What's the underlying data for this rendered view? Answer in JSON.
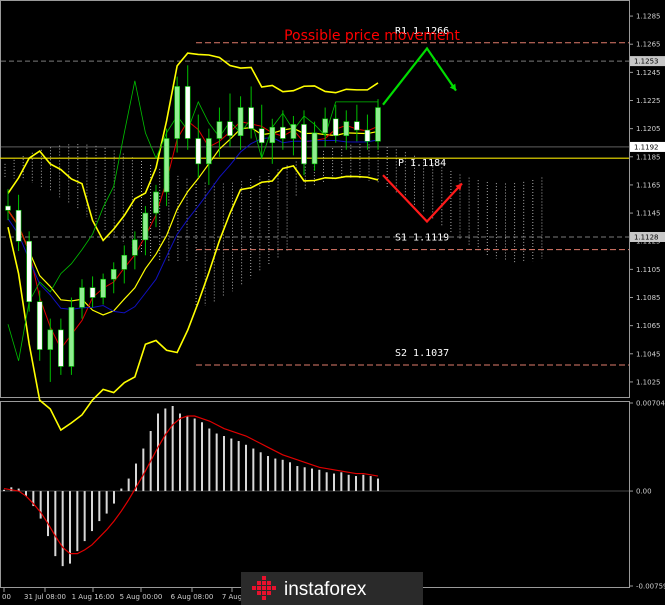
{
  "chart_data": [
    {
      "type": "candlestick",
      "title": "Possible price movement",
      "ylim": [
        1.1015,
        1.1295
      ],
      "y_ticks": [
        1.1285,
        1.1265,
        1.1245,
        1.1225,
        1.1205,
        1.1185,
        1.1165,
        1.1145,
        1.1125,
        1.1105,
        1.1085,
        1.1065,
        1.1045,
        1.1025
      ],
      "x_ticks": [
        "00",
        "31 Jul 08:00",
        "1 Aug 16:00",
        "5 Aug 00:00",
        "6 Aug 08:00",
        "7 Aug"
      ],
      "current_price_tag": "1.1192",
      "tag_1253": "1.1253",
      "tag_1128": "1.1128",
      "levels": [
        {
          "name": "R1",
          "label": "R1  1.1266",
          "value": 1.1266,
          "color": "#e07b6b"
        },
        {
          "name": "P",
          "label": "P  1.1184",
          "value": 1.1184,
          "color": "#f2e200"
        },
        {
          "name": "S1",
          "label": "S1  1.1119",
          "value": 1.1119,
          "color": "#e07b6b"
        },
        {
          "name": "S2",
          "label": "S2  1.1037",
          "value": 1.1037,
          "color": "#e07b6b"
        }
      ],
      "grey_lines": [
        1.1253,
        1.1128
      ],
      "colors": {
        "background": "#000000",
        "bull_body": "#90ee90",
        "bear_body": "#ffffff",
        "wick": "#00c000",
        "bollinger": "#ffff00",
        "tenkan": "#e00000",
        "kijun": "#1010c0",
        "chikou": "#00c000",
        "cloud_a": "#c8c8c8",
        "cloud_b": "#e08020",
        "arrow_up": "#00dd00",
        "arrow_down": "#ff1a1a"
      },
      "candles": [
        {
          "o": 1.115,
          "h": 1.1162,
          "l": 1.114,
          "c": 1.1147
        },
        {
          "o": 1.1147,
          "h": 1.1158,
          "l": 1.1118,
          "c": 1.1125
        },
        {
          "o": 1.1125,
          "h": 1.1132,
          "l": 1.1075,
          "c": 1.1082
        },
        {
          "o": 1.1082,
          "h": 1.109,
          "l": 1.104,
          "c": 1.1048
        },
        {
          "o": 1.1048,
          "h": 1.107,
          "l": 1.1025,
          "c": 1.1062
        },
        {
          "o": 1.1062,
          "h": 1.107,
          "l": 1.103,
          "c": 1.1036
        },
        {
          "o": 1.1036,
          "h": 1.1085,
          "l": 1.103,
          "c": 1.1078
        },
        {
          "o": 1.1078,
          "h": 1.1098,
          "l": 1.107,
          "c": 1.1092
        },
        {
          "o": 1.1092,
          "h": 1.11,
          "l": 1.1078,
          "c": 1.1085
        },
        {
          "o": 1.1085,
          "h": 1.1102,
          "l": 1.108,
          "c": 1.1098
        },
        {
          "o": 1.1098,
          "h": 1.111,
          "l": 1.1088,
          "c": 1.1105
        },
        {
          "o": 1.1105,
          "h": 1.1122,
          "l": 1.1095,
          "c": 1.1115
        },
        {
          "o": 1.1115,
          "h": 1.1132,
          "l": 1.1105,
          "c": 1.1126
        },
        {
          "o": 1.1126,
          "h": 1.115,
          "l": 1.1115,
          "c": 1.1145
        },
        {
          "o": 1.1145,
          "h": 1.1165,
          "l": 1.1135,
          "c": 1.116
        },
        {
          "o": 1.116,
          "h": 1.1205,
          "l": 1.115,
          "c": 1.1198
        },
        {
          "o": 1.1198,
          "h": 1.1242,
          "l": 1.1188,
          "c": 1.1235
        },
        {
          "o": 1.1235,
          "h": 1.125,
          "l": 1.119,
          "c": 1.1198
        },
        {
          "o": 1.1198,
          "h": 1.1215,
          "l": 1.117,
          "c": 1.118
        },
        {
          "o": 1.118,
          "h": 1.1205,
          "l": 1.1165,
          "c": 1.1198
        },
        {
          "o": 1.1198,
          "h": 1.122,
          "l": 1.1185,
          "c": 1.121
        },
        {
          "o": 1.121,
          "h": 1.123,
          "l": 1.1192,
          "c": 1.12
        },
        {
          "o": 1.12,
          "h": 1.1228,
          "l": 1.119,
          "c": 1.122
        },
        {
          "o": 1.122,
          "h": 1.1235,
          "l": 1.1198,
          "c": 1.1205
        },
        {
          "o": 1.1205,
          "h": 1.1222,
          "l": 1.1185,
          "c": 1.1195
        },
        {
          "o": 1.1195,
          "h": 1.1212,
          "l": 1.118,
          "c": 1.1206
        },
        {
          "o": 1.1206,
          "h": 1.1218,
          "l": 1.119,
          "c": 1.1198
        },
        {
          "o": 1.1198,
          "h": 1.1214,
          "l": 1.1186,
          "c": 1.1208
        },
        {
          "o": 1.1208,
          "h": 1.1218,
          "l": 1.1172,
          "c": 1.118
        },
        {
          "o": 1.118,
          "h": 1.121,
          "l": 1.1175,
          "c": 1.1202
        },
        {
          "o": 1.1202,
          "h": 1.122,
          "l": 1.1192,
          "c": 1.1212
        },
        {
          "o": 1.1212,
          "h": 1.1222,
          "l": 1.1195,
          "c": 1.12
        },
        {
          "o": 1.12,
          "h": 1.1218,
          "l": 1.119,
          "c": 1.121
        },
        {
          "o": 1.121,
          "h": 1.1222,
          "l": 1.1196,
          "c": 1.1204
        },
        {
          "o": 1.1204,
          "h": 1.1215,
          "l": 1.119,
          "c": 1.1196
        },
        {
          "o": 1.1196,
          "h": 1.1226,
          "l": 1.119,
          "c": 1.122
        }
      ],
      "macd_ylim": [
        -0.00759,
        0.00704
      ],
      "macd_ticks": [
        "0.00704",
        "0.00",
        "-0.00759"
      ],
      "macd_hist": [
        0.0001,
        0.0003,
        0.0002,
        -0.0004,
        -0.0012,
        -0.0022,
        -0.0036,
        -0.0052,
        -0.006,
        -0.0058,
        -0.0048,
        -0.004,
        -0.0032,
        -0.0024,
        -0.0018,
        -0.001,
        0.0002,
        0.001,
        0.0022,
        0.0034,
        0.0048,
        0.0062,
        0.0066,
        0.0068,
        0.0062,
        0.006,
        0.0058,
        0.0055,
        0.005,
        0.0046,
        0.0044,
        0.0042,
        0.004,
        0.0037,
        0.0034,
        0.0031,
        0.0028,
        0.0026,
        0.0025,
        0.0023,
        0.002,
        0.0019,
        0.0018,
        0.0017,
        0.0015,
        0.0014,
        0.0015,
        0.0013,
        0.0012,
        0.0013,
        0.0012,
        0.001
      ],
      "macd_signal": [
        0.0002,
        0.0001,
        0.0,
        -0.0004,
        -0.001,
        -0.0017,
        -0.0026,
        -0.0036,
        -0.0045,
        -0.005,
        -0.005,
        -0.0047,
        -0.0043,
        -0.0037,
        -0.0031,
        -0.0024,
        -0.0016,
        -0.0007,
        0.0003,
        0.0013,
        0.0024,
        0.0035,
        0.0045,
        0.0053,
        0.0058,
        0.006,
        0.006,
        0.0058,
        0.0056,
        0.0053,
        0.005,
        0.0048,
        0.0046,
        0.0044,
        0.0041,
        0.0038,
        0.0035,
        0.0032,
        0.0029,
        0.0027,
        0.0025,
        0.0023,
        0.0021,
        0.0019,
        0.0018,
        0.0017,
        0.0016,
        0.0015,
        0.0014,
        0.0014,
        0.0013,
        0.0012
      ]
    }
  ],
  "branding": {
    "logo_text": "instaforex"
  }
}
